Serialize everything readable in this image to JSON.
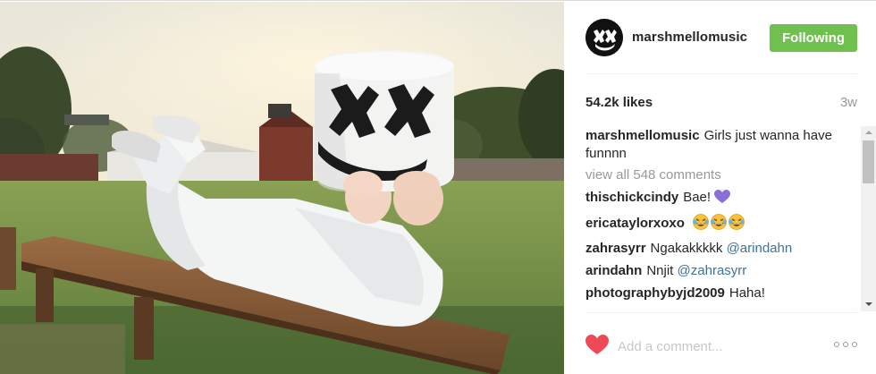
{
  "post": {
    "username": "marshmellomusic",
    "follow_label": "Following",
    "likes": "54.2k likes",
    "time_ago": "3w",
    "caption": {
      "username": "marshmellomusic",
      "text": "Girls just wanna have funnnn"
    },
    "view_all": "view all 548 comments",
    "comments": [
      {
        "username": "thischickcindy",
        "text": "Bae! ",
        "emoji": "purple-heart"
      },
      {
        "username": "ericataylorxoxo",
        "text": "",
        "emoji": "tears-of-joy-x3"
      },
      {
        "username": "zahrasyrr",
        "text": "Ngakakkkkk ",
        "mention": "@arindahn"
      },
      {
        "username": "arindahn",
        "text": "Nnjit ",
        "mention": "@zahrasyrr"
      },
      {
        "username": "photographybyjd2009",
        "text": "Haha!"
      }
    ],
    "add_comment_placeholder": "Add a comment...",
    "icons": {
      "like": "heart-icon",
      "more": "more-options-icon",
      "avatar": "marshmello-avatar-icon"
    },
    "colors": {
      "following_button": "#70c050",
      "heart": "#ed4956",
      "mention": "#3f729b",
      "muted": "#999999"
    }
  }
}
